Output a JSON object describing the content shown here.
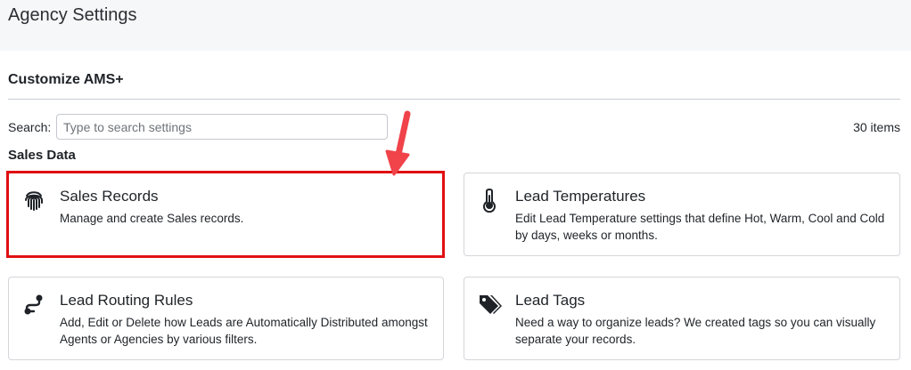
{
  "header": {
    "title": "Agency Settings"
  },
  "section": {
    "title": "Customize AMS+"
  },
  "search": {
    "label": "Search:",
    "placeholder": "Type to search settings"
  },
  "items_count": "30 items",
  "group": {
    "title": "Sales Data"
  },
  "cards": [
    {
      "title": "Sales Records",
      "description": "Manage and create Sales records.",
      "icon": "fingerprint-icon"
    },
    {
      "title": "Lead Temperatures",
      "description": "Edit Lead Temperature settings that define Hot, Warm, Cool and Cold by days, weeks or months.",
      "icon": "thermometer-icon"
    },
    {
      "title": "Lead Routing Rules",
      "description": "Add, Edit or Delete how Leads are Automatically Distributed amongst Agents or Agencies by various filters.",
      "icon": "route-icon"
    },
    {
      "title": "Lead Tags",
      "description": "Need a way to organize leads? We created tags so you can visually separate your records.",
      "icon": "tags-icon"
    }
  ],
  "colors": {
    "highlight": "#e10f12",
    "arrow": "#f0434a",
    "topbar": "#f6f7f9"
  }
}
